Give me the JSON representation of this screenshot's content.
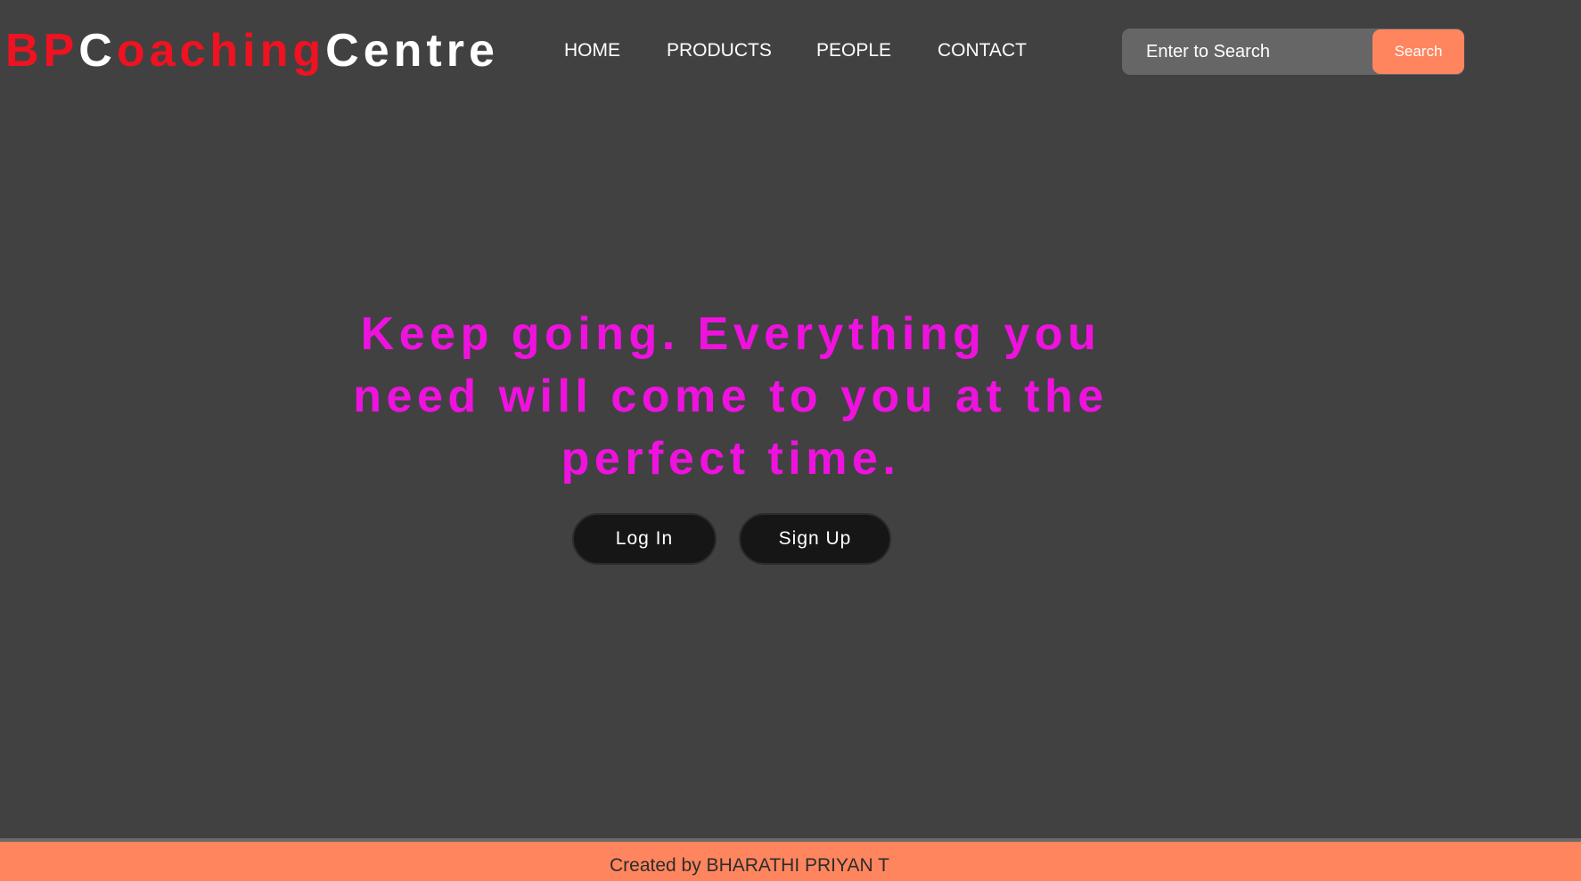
{
  "header": {
    "logo": {
      "part1": "BP",
      "part2": "C",
      "part3": "oaching",
      "part4": "Centre"
    },
    "nav": [
      {
        "label": "HOME"
      },
      {
        "label": "PRODUCTS"
      },
      {
        "label": "PEOPLE"
      },
      {
        "label": "CONTACT"
      }
    ],
    "search": {
      "placeholder": "Enter to Search",
      "button_label": "Search"
    }
  },
  "hero": {
    "quote": "Keep going. Everything you need will come to you at the perfect time.",
    "login_label": "Log In",
    "signup_label": "Sign Up"
  },
  "footer": {
    "text": "Created by BHARATHI PRIYAN T"
  },
  "colors": {
    "background": "#414141",
    "logo_red": "#ef1221",
    "quote_magenta": "#ef12df",
    "accent_orange": "#ff855e",
    "button_dark": "#161616"
  }
}
